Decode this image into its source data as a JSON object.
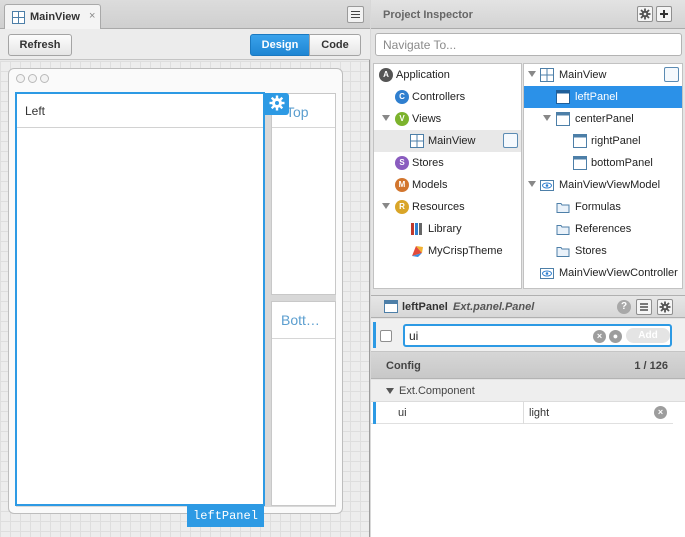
{
  "colors": {
    "accent": "#2d9ae4",
    "selection": "#2b91e8"
  },
  "document_tab": {
    "label": "MainView",
    "close_glyph": "×",
    "icon": "panel-grid-icon"
  },
  "canvas_toolbar": {
    "refresh_label": "Refresh",
    "design_label": "Design",
    "code_label": "Code",
    "active_mode": "Design"
  },
  "canvas": {
    "left_panel_title": "Left",
    "top_panel_title": "Top",
    "bottom_panel_title": "Bott…",
    "selected_component_tag": "leftPanel"
  },
  "inspector": {
    "title": "Project Inspector",
    "navigate_placeholder": "Navigate To...",
    "left_tree": [
      {
        "label": "Application",
        "icon": "letter-A-icon",
        "expandable": false
      },
      {
        "label": "Controllers",
        "icon": "letter-C-icon",
        "expandable": false
      },
      {
        "label": "Views",
        "icon": "letter-V-icon",
        "expandable": true
      },
      {
        "label": "MainView",
        "icon": "panel-grid-icon",
        "child": true,
        "highlighted": true
      },
      {
        "label": "Stores",
        "icon": "letter-S-icon",
        "expandable": false
      },
      {
        "label": "Models",
        "icon": "letter-M-icon",
        "expandable": false
      },
      {
        "label": "Resources",
        "icon": "letter-R-icon",
        "expandable": true
      },
      {
        "label": "Library",
        "icon": "library-icon",
        "child": true
      },
      {
        "label": "MyCrispTheme",
        "icon": "theme-icon",
        "child": true
      }
    ],
    "right_tree": [
      {
        "label": "MainView",
        "icon": "panel-grid-icon",
        "expandable": true
      },
      {
        "label": "leftPanel",
        "icon": "panel-icon",
        "selected": true
      },
      {
        "label": "centerPanel",
        "icon": "panel-icon",
        "expandable": true
      },
      {
        "label": "rightPanel",
        "icon": "panel-icon"
      },
      {
        "label": "bottomPanel",
        "icon": "panel-icon"
      },
      {
        "label": "MainViewViewModel",
        "icon": "viewmodel-icon",
        "expandable": true
      },
      {
        "label": "Formulas",
        "icon": "folder-icon"
      },
      {
        "label": "References",
        "icon": "folder-icon"
      },
      {
        "label": "Stores",
        "icon": "folder-icon"
      },
      {
        "label": "MainViewViewController",
        "icon": "controller-icon"
      }
    ]
  },
  "properties": {
    "component_name": "leftPanel",
    "component_class": "Ext.panel.Panel",
    "filter_value": "ui",
    "add_label": "Add",
    "config_label": "Config",
    "config_count": "1 / 126",
    "group_label": "Ext.Component",
    "rows": [
      {
        "name": "ui",
        "value": "light"
      }
    ]
  }
}
